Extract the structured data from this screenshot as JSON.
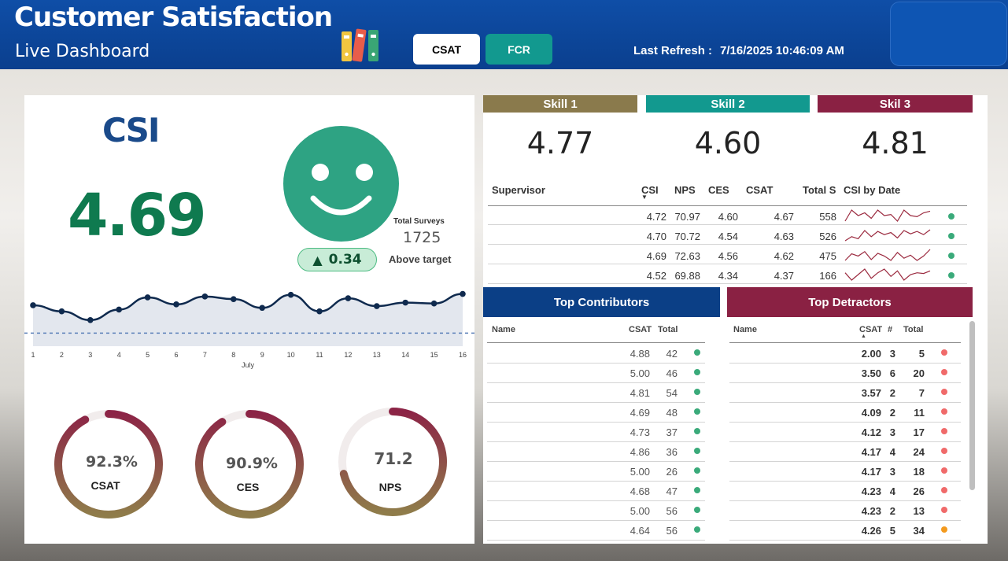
{
  "header": {
    "title": "Customer Satisfaction",
    "subtitle": "Live Dashboard",
    "tabs": [
      {
        "label": "CSAT",
        "active": true
      },
      {
        "label": "FCR",
        "active": false
      }
    ],
    "refresh_label": "Last Refresh :",
    "refresh_value": "7/16/2025 10:46:09 AM",
    "books_icon": "books-icon"
  },
  "colors": {
    "brand_blue": "#0b3f86",
    "green": "#0f7a4f",
    "teal": "#12998f",
    "maroon": "#8a2143",
    "olive": "#8a7a4c",
    "dot_green": "#3aaa7a",
    "dot_red": "#f06a6a",
    "dot_orange": "#f39a1e"
  },
  "csi": {
    "title": "CSI",
    "value": "4.69",
    "face_icon": "smiley-face-icon",
    "total_surveys_label": "Total Surveys",
    "total_surveys_value": "1725",
    "delta": "0.34",
    "delta_icon": "triangle-up-icon",
    "status": "Above target"
  },
  "trend": {
    "month_label": "July",
    "days": [
      "1",
      "2",
      "3",
      "4",
      "5",
      "6",
      "7",
      "8",
      "9",
      "10",
      "11",
      "12",
      "13",
      "14",
      "15",
      "16"
    ],
    "values": [
      4.67,
      4.6,
      4.5,
      4.62,
      4.76,
      4.68,
      4.77,
      4.74,
      4.64,
      4.79,
      4.6,
      4.75,
      4.66,
      4.7,
      4.69,
      4.8
    ],
    "target": 4.35,
    "y_range": [
      4.2,
      4.85
    ]
  },
  "gauges": [
    {
      "value": "92.3%",
      "label": "CSAT",
      "fraction": 0.923
    },
    {
      "value": "90.9%",
      "label": "CES",
      "fraction": 0.909
    },
    {
      "value": "71.2",
      "label": "NPS",
      "fraction": 0.712
    }
  ],
  "skills": [
    {
      "label": "Skill 1",
      "value": "4.77",
      "color": "#8a7a4c"
    },
    {
      "label": "Skill 2",
      "value": "4.60",
      "color": "#12998f"
    },
    {
      "label": "Skil 3",
      "value": "4.81",
      "color": "#8a2143"
    }
  ],
  "supervisor_table": {
    "headers": [
      "Supervisor",
      "CSI",
      "NPS",
      "CES",
      "CSAT",
      "Total S",
      "CSI by Date"
    ],
    "rows": [
      {
        "csi": "4.72",
        "nps": "70.97",
        "ces": "4.60",
        "csat": "4.67",
        "total": "558",
        "spark": [
          4.6,
          4.8,
          4.7,
          4.75,
          4.65,
          4.8,
          4.7,
          4.72,
          4.6,
          4.8,
          4.7,
          4.68,
          4.75,
          4.78
        ],
        "status": "green"
      },
      {
        "csi": "4.70",
        "nps": "70.72",
        "ces": "4.54",
        "csat": "4.63",
        "total": "526",
        "spark": [
          4.55,
          4.65,
          4.6,
          4.8,
          4.65,
          4.78,
          4.7,
          4.75,
          4.62,
          4.8,
          4.72,
          4.78,
          4.7,
          4.82
        ],
        "status": "green"
      },
      {
        "csi": "4.69",
        "nps": "72.63",
        "ces": "4.56",
        "csat": "4.62",
        "total": "475",
        "spark": [
          4.6,
          4.75,
          4.7,
          4.8,
          4.62,
          4.76,
          4.7,
          4.6,
          4.78,
          4.65,
          4.72,
          4.6,
          4.7,
          4.85
        ],
        "status": "green"
      },
      {
        "csi": "4.52",
        "nps": "69.88",
        "ces": "4.34",
        "csat": "4.37",
        "total": "166",
        "spark": [
          4.6,
          4.4,
          4.55,
          4.7,
          4.45,
          4.6,
          4.7,
          4.5,
          4.65,
          4.4,
          4.55,
          4.6,
          4.58,
          4.65
        ],
        "status": "green"
      }
    ]
  },
  "top_contributors": {
    "title": "Top Contributors",
    "headers": [
      "Name",
      "CSAT",
      "Total"
    ],
    "rows": [
      {
        "csat": "4.88",
        "total": "42",
        "status": "green"
      },
      {
        "csat": "5.00",
        "total": "46",
        "status": "green"
      },
      {
        "csat": "4.81",
        "total": "54",
        "status": "green"
      },
      {
        "csat": "4.69",
        "total": "48",
        "status": "green"
      },
      {
        "csat": "4.73",
        "total": "37",
        "status": "green"
      },
      {
        "csat": "4.86",
        "total": "36",
        "status": "green"
      },
      {
        "csat": "5.00",
        "total": "26",
        "status": "green"
      },
      {
        "csat": "4.68",
        "total": "47",
        "status": "green"
      },
      {
        "csat": "5.00",
        "total": "56",
        "status": "green"
      },
      {
        "csat": "4.64",
        "total": "56",
        "status": "green"
      }
    ]
  },
  "top_detractors": {
    "title": "Top Detractors",
    "headers": [
      "Name",
      "CSAT",
      "#",
      "Total"
    ],
    "rows": [
      {
        "csat": "2.00",
        "count": "3",
        "total": "5",
        "status": "red"
      },
      {
        "csat": "3.50",
        "count": "6",
        "total": "20",
        "status": "red"
      },
      {
        "csat": "3.57",
        "count": "2",
        "total": "7",
        "status": "red"
      },
      {
        "csat": "4.09",
        "count": "2",
        "total": "11",
        "status": "red"
      },
      {
        "csat": "4.12",
        "count": "3",
        "total": "17",
        "status": "red"
      },
      {
        "csat": "4.17",
        "count": "4",
        "total": "24",
        "status": "red"
      },
      {
        "csat": "4.17",
        "count": "3",
        "total": "18",
        "status": "red"
      },
      {
        "csat": "4.23",
        "count": "4",
        "total": "26",
        "status": "red"
      },
      {
        "csat": "4.23",
        "count": "2",
        "total": "13",
        "status": "red"
      },
      {
        "csat": "4.26",
        "count": "5",
        "total": "34",
        "status": "orange"
      }
    ]
  }
}
